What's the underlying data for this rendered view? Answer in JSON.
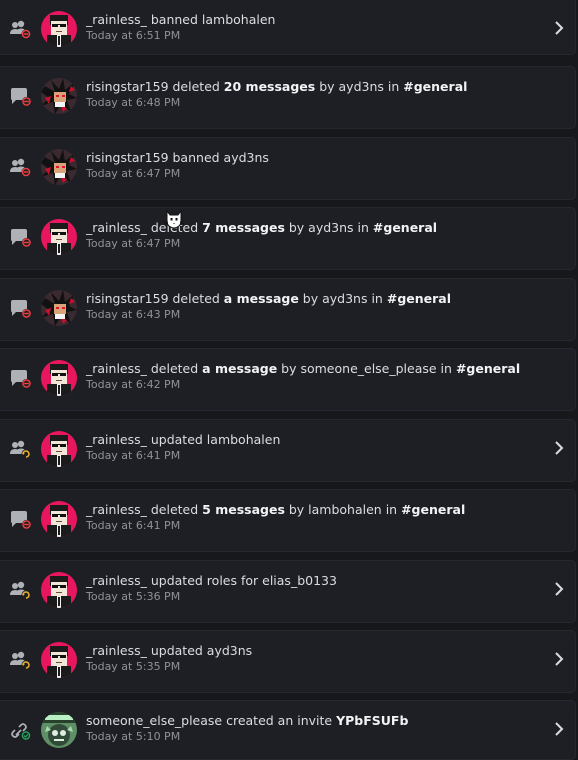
{
  "colors": {
    "background": "#17181c",
    "card": "#1e1f24",
    "text": "#dbdee1",
    "muted": "#8e9299",
    "ban_red": "#f23f43",
    "update_amber": "#f0b232",
    "invite_green": "#23a55a"
  },
  "entries": [
    {
      "type": "member-ban",
      "avatar": "rainless",
      "parts": [
        {
          "t": "_rainless_ banned lambohalen",
          "b": false
        }
      ],
      "time": "Today at 6:51 PM",
      "chevron": true
    },
    {
      "type": "message-delete",
      "avatar": "risingstar",
      "parts": [
        {
          "t": "risingstar159 deleted ",
          "b": false
        },
        {
          "t": "20 messages",
          "b": true
        },
        {
          "t": " by ayd3ns in ",
          "b": false
        },
        {
          "t": "#general",
          "b": true
        }
      ],
      "time": "Today at 6:48 PM",
      "chevron": false
    },
    {
      "type": "member-ban",
      "avatar": "risingstar",
      "parts": [
        {
          "t": "risingstar159 banned ayd3ns",
          "b": false
        }
      ],
      "time": "Today at 6:47 PM",
      "chevron": false
    },
    {
      "type": "message-delete",
      "avatar": "rainless",
      "parts": [
        {
          "t": "_rainless_ deleted ",
          "b": false
        },
        {
          "t": "7 messages",
          "b": true
        },
        {
          "t": " by ayd3ns in ",
          "b": false
        },
        {
          "t": "#general",
          "b": true
        }
      ],
      "time": "Today at 6:47 PM",
      "chevron": false
    },
    {
      "type": "message-delete",
      "avatar": "risingstar",
      "parts": [
        {
          "t": "risingstar159 deleted ",
          "b": false
        },
        {
          "t": "a message",
          "b": true
        },
        {
          "t": " by ayd3ns in ",
          "b": false
        },
        {
          "t": "#general",
          "b": true
        }
      ],
      "time": "Today at 6:43 PM",
      "chevron": false
    },
    {
      "type": "message-delete",
      "avatar": "rainless",
      "parts": [
        {
          "t": "_rainless_ deleted ",
          "b": false
        },
        {
          "t": "a message",
          "b": true
        },
        {
          "t": " by someone_else_please in ",
          "b": false
        },
        {
          "t": "#general",
          "b": true
        }
      ],
      "time": "Today at 6:42 PM",
      "chevron": false
    },
    {
      "type": "member-update",
      "avatar": "rainless",
      "parts": [
        {
          "t": "_rainless_ updated lambohalen",
          "b": false
        }
      ],
      "time": "Today at 6:41 PM",
      "chevron": true
    },
    {
      "type": "message-delete",
      "avatar": "rainless",
      "parts": [
        {
          "t": "_rainless_ deleted ",
          "b": false
        },
        {
          "t": "5 messages",
          "b": true
        },
        {
          "t": " by lambohalen in ",
          "b": false
        },
        {
          "t": "#general",
          "b": true
        }
      ],
      "time": "Today at 6:41 PM",
      "chevron": false
    },
    {
      "type": "member-update",
      "avatar": "rainless",
      "parts": [
        {
          "t": "_rainless_ updated roles for elias_b0133",
          "b": false
        }
      ],
      "time": "Today at 5:36 PM",
      "chevron": true
    },
    {
      "type": "member-update",
      "avatar": "rainless",
      "parts": [
        {
          "t": "_rainless_ updated ayd3ns",
          "b": false
        }
      ],
      "time": "Today at 5:35 PM",
      "chevron": true
    },
    {
      "type": "invite-create",
      "avatar": "someone",
      "parts": [
        {
          "t": "someone_else_please created an invite ",
          "b": false
        },
        {
          "t": "YPbFSUFb",
          "b": true
        }
      ],
      "time": "Today at 5:10 PM",
      "chevron": true
    }
  ]
}
